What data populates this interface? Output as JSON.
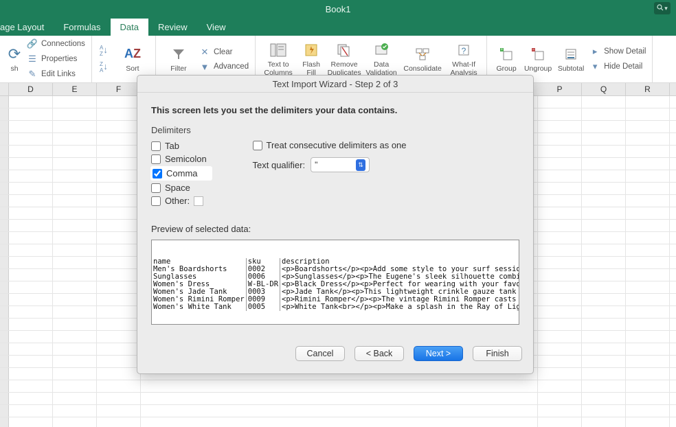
{
  "window": {
    "title": "Book1"
  },
  "tabs": {
    "page_layout": "age Layout",
    "formulas": "Formulas",
    "data": "Data",
    "review": "Review",
    "view": "View",
    "active": "data"
  },
  "ribbon": {
    "refresh": "sh",
    "connections": "Connections",
    "properties": "Properties",
    "edit_links": "Edit Links",
    "sort": "Sort",
    "filter": "Filter",
    "clear": "Clear",
    "advanced": "Advanced",
    "text_to_columns": "Text to\nColumns",
    "flash_fill": "Flash\nFill",
    "remove_duplicates": "Remove\nDuplicates",
    "data_validation": "Data\nValidation",
    "consolidate": "Consolidate",
    "what_if": "What-If\nAnalysis",
    "group": "Group",
    "ungroup": "Ungroup",
    "subtotal": "Subtotal",
    "show_detail": "Show Detail",
    "hide_detail": "Hide Detail"
  },
  "columns": [
    "D",
    "E",
    "F",
    "",
    "",
    "",
    "",
    "",
    "",
    "",
    "",
    "P",
    "Q",
    "R"
  ],
  "dialog": {
    "title": "Text Import Wizard - Step 2 of 3",
    "description": "This screen lets you set the delimiters your data contains.",
    "section_label": "Delimiters",
    "tab_label": "Tab",
    "semicolon_label": "Semicolon",
    "comma_label": "Comma",
    "space_label": "Space",
    "other_label": "Other:",
    "other_value": "",
    "tab_checked": false,
    "semicolon_checked": false,
    "comma_checked": true,
    "space_checked": false,
    "other_checked": false,
    "treat_consecutive_label": "Treat consecutive delimiters as one",
    "treat_consecutive_checked": false,
    "text_qualifier_label": "Text qualifier:",
    "text_qualifier_value": "\"",
    "preview_label": "Preview of selected data:",
    "preview": {
      "headers": [
        "name",
        "sku",
        "description"
      ],
      "rows": [
        [
          "Men's Boardshorts",
          "0002",
          "<p>Boardshorts</p><p>Add some style to your surf sessions with these classic "
        ],
        [
          "Sunglasses",
          "0006",
          "<p>Sunglasses</p><p>The Eugene's sleek silhouette combines a metal rim and br"
        ],
        [
          "Women's Dress",
          "W-BL-DR",
          "<p>Black Dress</p><p>Perfect for wearing with your favorite flat sandals or t"
        ],
        [
          "Women's Jade Tank",
          "0003",
          "<p>Jade Tank</p><p>This lightweight crinkle gauze tank features an allover fl"
        ],
        [
          "Women's Rimini Romper",
          "0009",
          "<p>Rimini Romper</p><p>The vintage Rimini Romper casts a cool and casual vibe"
        ],
        [
          "Women's White Tank",
          "0005",
          "<p>White Tank<br></p><p>Make a splash in the Ray of Light tank. With a croppe"
        ]
      ]
    },
    "buttons": {
      "cancel": "Cancel",
      "back": "< Back",
      "next": "Next >",
      "finish": "Finish"
    }
  }
}
